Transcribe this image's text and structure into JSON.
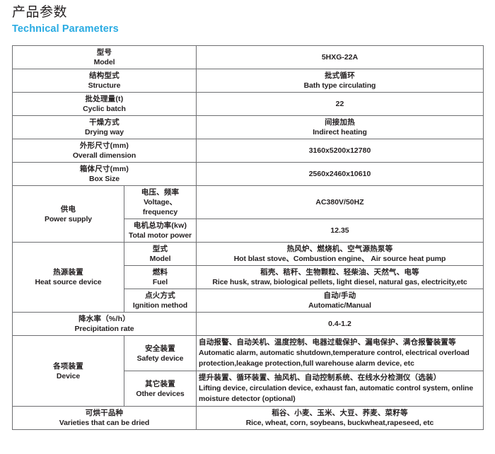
{
  "heading": {
    "title_cn": "产品参数",
    "title_en": "Technical Parameters",
    "accent_color": "#29abe2"
  },
  "table": {
    "rows": {
      "model": {
        "label_cn": "型号",
        "label_en": "Model",
        "value": "5HXG-22A"
      },
      "structure": {
        "label_cn": "结构型式",
        "label_en": "Structure",
        "value_cn": "批式循环",
        "value_en": "Bath type circulating"
      },
      "cyclic_batch": {
        "label_cn": "批处理量(t)",
        "label_en": "Cyclic batch",
        "value": "22"
      },
      "drying_way": {
        "label_cn": "干燥方式",
        "label_en": "Drying way",
        "value_cn": "间接加热",
        "value_en": "Indirect heating"
      },
      "overall_dimension": {
        "label_cn": "外形尺寸(mm)",
        "label_en": "Overall dimension",
        "value": "3160x5200x12780"
      },
      "box_size": {
        "label_cn": "箱体尺寸(mm)",
        "label_en": "Box Size",
        "value": "2560x2460x10610"
      },
      "power_supply": {
        "label_cn": "供电",
        "label_en": "Power supply",
        "voltage": {
          "sub_cn": "电压、频率",
          "sub_en": "Voltage、frequency",
          "value": "AC380V/50HZ"
        },
        "motor_power": {
          "sub_cn": "电机总功率(kw)",
          "sub_en": "Total motor power",
          "value": "12.35"
        }
      },
      "heat_source": {
        "label_cn": "热源装置",
        "label_en": "Heat source device",
        "model": {
          "sub_cn": "型式",
          "sub_en": "Model",
          "value_cn": "热风炉、燃烧机、空气源热泵等",
          "value_en": "Hot blast stove、Combustion engine、 Air source heat pump"
        },
        "fuel": {
          "sub_cn": "燃料",
          "sub_en": "Fuel",
          "value_cn": "稻壳、秸秆、生物颗粒、轻柴油、天然气、电等",
          "value_en": "Rice husk, straw, biological pellets, light diesel, natural gas, electricity,etc"
        },
        "ignition": {
          "sub_cn": "点火方式",
          "sub_en": "Ignition method",
          "value_cn": "自动/手动",
          "value_en": "Automatic/Manual"
        }
      },
      "precipitation_rate": {
        "label_cn": "降水率（%/h）",
        "label_en": "Precipitation rate",
        "value": "0.4-1.2"
      },
      "device": {
        "label_cn": "各项装置",
        "label_en": "Device",
        "safety": {
          "sub_cn": "安全装置",
          "sub_en": "Safety device",
          "value_cn": "自动报警、自动关机、温度控制、电器过载保护、漏电保护、满仓报警装置等",
          "value_en": "Automatic alarm, automatic shutdown,temperature control, electrical overload protection,leakage protection,full warehouse alarm device, etc"
        },
        "other": {
          "sub_cn": "其它装置",
          "sub_en": "Other devices",
          "value_cn": "提升装置、循环装置、抽风机、自动控制系统、在线水分检测仪（选装）",
          "value_en": "Lifting device, circulation device, exhaust fan, automatic control system, online moisture detector (optional)"
        }
      },
      "varieties": {
        "label_cn": "可烘干品种",
        "label_en": "Varieties that can be dried",
        "value_cn": "稻谷、小麦、玉米、大豆、荞麦、菜籽等",
        "value_en": "Rice, wheat, corn, soybeans, buckwheat,rapeseed, etc"
      }
    }
  }
}
